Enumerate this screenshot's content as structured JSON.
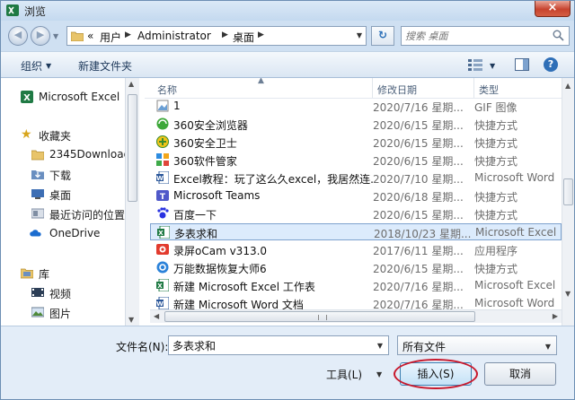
{
  "window": {
    "title": "浏览",
    "close_label": "×"
  },
  "address": {
    "prefix": "«",
    "crumbs": [
      "用户",
      "Administrator",
      "桌面"
    ],
    "search_placeholder": "搜索 桌面"
  },
  "toolbar": {
    "organize": "组织",
    "new_folder": "新建文件夹"
  },
  "sidebar": {
    "items": [
      {
        "label": "Microsoft Excel",
        "icon": "excel-icon"
      },
      {
        "label": "收藏夹",
        "icon": "star-icon"
      },
      {
        "label": "2345Downloads",
        "icon": "folder-icon"
      },
      {
        "label": "下载",
        "icon": "download-folder-icon"
      },
      {
        "label": "桌面",
        "icon": "desktop-icon"
      },
      {
        "label": "最近访问的位置",
        "icon": "recent-places-icon"
      },
      {
        "label": "OneDrive",
        "icon": "cloud-icon"
      },
      {
        "label": "库",
        "icon": "library-icon"
      },
      {
        "label": "视频",
        "icon": "video-icon"
      },
      {
        "label": "图片",
        "icon": "pictures-icon"
      }
    ]
  },
  "columns": {
    "name": "名称",
    "date": "修改日期",
    "type": "类型"
  },
  "files": [
    {
      "name": "1",
      "date": "2020/7/16 星期...",
      "type": "GIF 图像",
      "icon": "gif-image-icon"
    },
    {
      "name": "360安全浏览器",
      "date": "2020/6/15 星期...",
      "type": "快捷方式",
      "icon": "browser-360-icon"
    },
    {
      "name": "360安全卫士",
      "date": "2020/6/15 星期...",
      "type": "快捷方式",
      "icon": "security-360-icon"
    },
    {
      "name": "360软件管家",
      "date": "2020/6/15 星期...",
      "type": "快捷方式",
      "icon": "software-manager-icon"
    },
    {
      "name": "Excel教程：玩了这么久excel，我居然连...",
      "date": "2020/7/10 星期...",
      "type": "Microsoft Word",
      "icon": "word-doc-icon"
    },
    {
      "name": "Microsoft Teams",
      "date": "2020/6/18 星期...",
      "type": "快捷方式",
      "icon": "teams-icon"
    },
    {
      "name": "百度一下",
      "date": "2020/6/15 星期...",
      "type": "快捷方式",
      "icon": "baidu-icon"
    },
    {
      "name": "多表求和",
      "date": "2018/10/23 星期...",
      "type": "Microsoft Excel",
      "icon": "excel-file-icon"
    },
    {
      "name": "录屏oCam v313.0",
      "date": "2017/6/11 星期...",
      "type": "应用程序",
      "icon": "ocam-icon"
    },
    {
      "name": "万能数据恢复大师6",
      "date": "2020/6/15 星期...",
      "type": "快捷方式",
      "icon": "recovery-icon"
    },
    {
      "name": "新建 Microsoft Excel 工作表",
      "date": "2020/7/16 星期...",
      "type": "Microsoft Excel",
      "icon": "excel-file-icon"
    },
    {
      "name": "新建 Microsoft Word 文档",
      "date": "2020/7/16 星期...",
      "type": "Microsoft Word",
      "icon": "word-doc-icon"
    }
  ],
  "selected_index": 7,
  "bottom": {
    "filename_label": "文件名(N):",
    "filename_value": "多表求和",
    "filetype_value": "所有文件",
    "tools_label": "工具(L)",
    "insert_label": "插入(S)",
    "cancel_label": "取消"
  },
  "colors": {
    "highlight_circle": "#c8182c",
    "selection": "#dcebfc"
  }
}
